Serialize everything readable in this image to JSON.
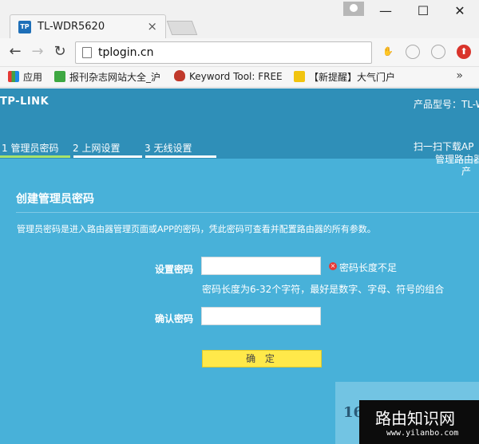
{
  "browser": {
    "tab_title": "TL-WDR5620",
    "tab_favicon": "TP",
    "tab_close": "×",
    "url": "tplogin.cn",
    "window_controls": {
      "minimize": "—",
      "maximize": "☐",
      "close": "✕"
    },
    "nav": {
      "back": "←",
      "forward": "→",
      "reload": "↻"
    },
    "bookmarks": [
      {
        "label": "应用",
        "icon": "apps-grid-icon",
        "color": "#e5a12b"
      },
      {
        "label": "报刊杂志网站大全_沪",
        "icon": "green-check-icon",
        "color": "#3ea842"
      },
      {
        "label": "Keyword Tool: FREE",
        "icon": "flame-icon",
        "color": "#c0392b"
      },
      {
        "label": "【新提醒】大气门户",
        "icon": "trophy-icon",
        "color": "#f1c40f"
      }
    ],
    "bookmarks_more": "»"
  },
  "header": {
    "logo": "TP-LINK",
    "model": "产品型号：TL-W",
    "steps": [
      {
        "label": "1 管理员密码",
        "active": true
      },
      {
        "label": "2 上网设置",
        "active": false
      },
      {
        "label": "3 无线设置",
        "active": false
      }
    ],
    "qr_line1": "扫一扫下载AP",
    "qr_line2": "管理路由器",
    "qr_line3": "产"
  },
  "form": {
    "title": "创建管理员密码",
    "description": "管理员密码是进入路由器管理页面或APP的密码，凭此密码可查看并配置路由器的所有参数。",
    "password_label": "设置密码",
    "password_value": "",
    "error_icon": "×",
    "error_text": "密码长度不足",
    "hint": "密码长度为6-32个字符，最好是数字、字母、符号的组合",
    "confirm_label": "确认密码",
    "confirm_value": "",
    "submit": "确 定"
  },
  "watermark": {
    "number": "16",
    "cn": "路由知识网",
    "url": "www.yilanbo.com"
  },
  "colors": {
    "page_bg": "#48b1d9",
    "header_bg": "#2f8fb8",
    "active_step": "#a8e36a",
    "button": "#ffe94a",
    "error": "#e53935"
  }
}
